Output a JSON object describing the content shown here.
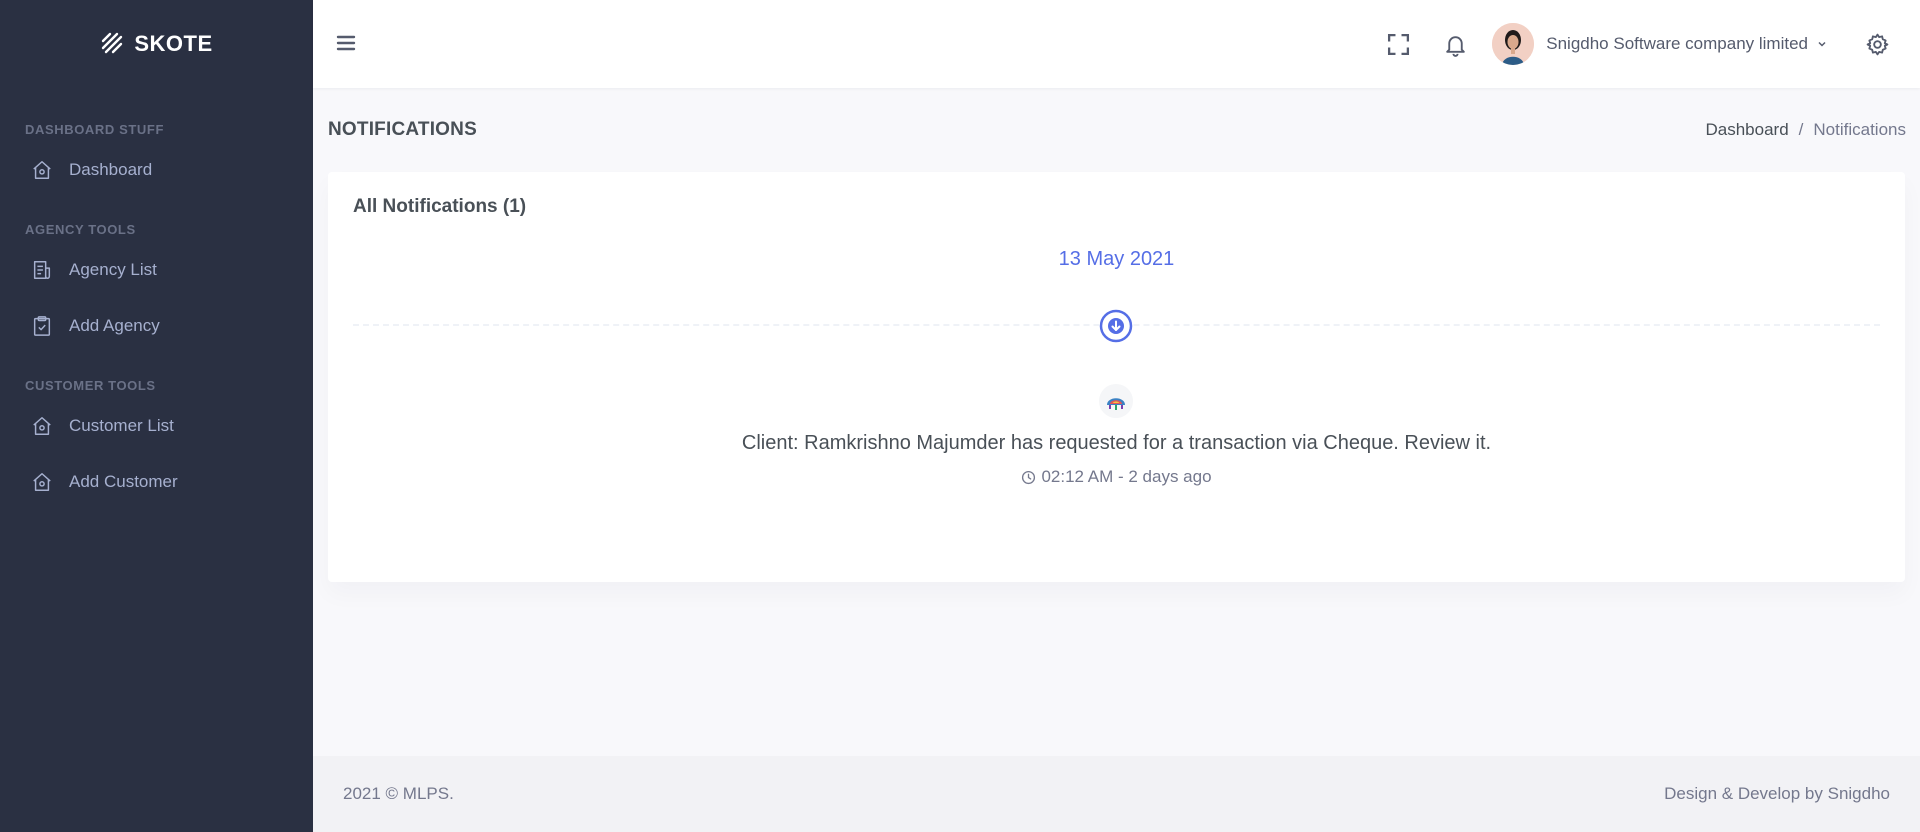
{
  "brand": {
    "name": "SKOTE"
  },
  "sidebar": {
    "sections": [
      {
        "title": "DASHBOARD STUFF",
        "items": [
          {
            "label": "Dashboard",
            "icon": "home-icon"
          }
        ]
      },
      {
        "title": "AGENCY TOOLS",
        "items": [
          {
            "label": "Agency List",
            "icon": "receipt-icon"
          },
          {
            "label": "Add Agency",
            "icon": "clipboard-check-icon"
          }
        ]
      },
      {
        "title": "CUSTOMER TOOLS",
        "items": [
          {
            "label": "Customer List",
            "icon": "home-icon"
          },
          {
            "label": "Add Customer",
            "icon": "home-icon"
          }
        ]
      }
    ]
  },
  "topbar": {
    "menu_icon": "hamburger-icon",
    "fullscreen_icon": "fullscreen-icon",
    "notifications_icon": "bell-icon",
    "user_name": "Snigdho Software company limited",
    "settings_icon": "gear-icon"
  },
  "page": {
    "title": "NOTIFICATIONS",
    "breadcrumb": {
      "parent": "Dashboard",
      "separator": "/",
      "current": "Notifications"
    }
  },
  "card": {
    "title": "All Notifications (1)",
    "date": "13 May 2021",
    "notification": {
      "text": "Client: Ramkrishno Majumder has requested for a transaction via Cheque. Review it.",
      "time": "02:12 AM - 2 days ago"
    }
  },
  "footer": {
    "left": "2021 © MLPS.",
    "right": "Design & Develop by Snigdho"
  },
  "colors": {
    "sidebar_bg": "#2a3042",
    "sidebar_text": "#a6b0cf",
    "sidebar_section": "#6a7187",
    "primary": "#556ee6",
    "page_bg": "#f8f8fb",
    "text": "#495057",
    "muted": "#74788d"
  }
}
